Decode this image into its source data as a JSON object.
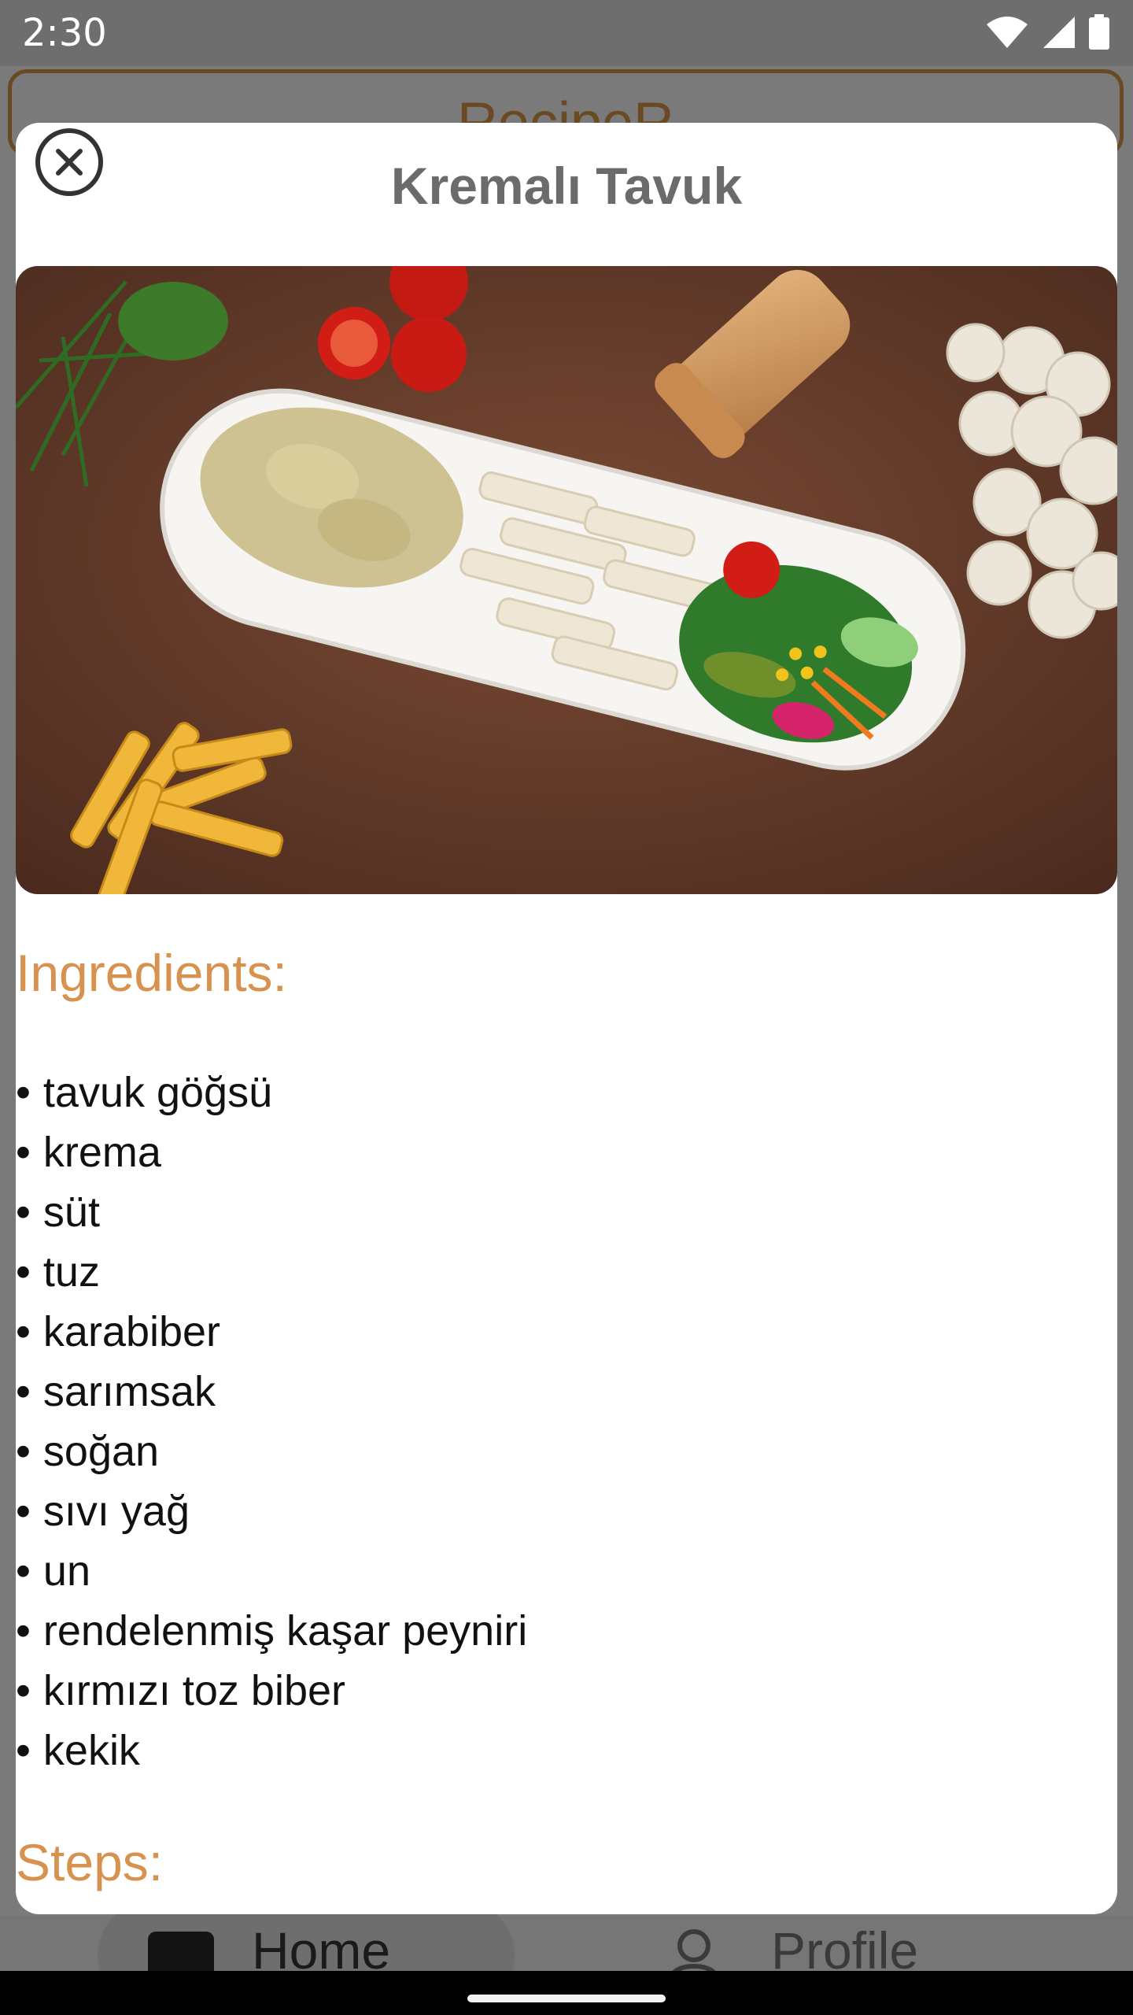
{
  "status_bar": {
    "time": "2:30",
    "icons": [
      "wifi-icon",
      "signal-icon",
      "battery-icon"
    ]
  },
  "background_app": {
    "header_title": "RecipeR",
    "nav": {
      "home_label": "Home",
      "profile_label": "Profile"
    }
  },
  "modal": {
    "title": "Kremalı Tavuk",
    "close_icon": "close-circle-icon",
    "image": "creamy-chicken-pasta-photo",
    "ingredients_heading": "Ingredients:",
    "bullet": "•",
    "ingredients": [
      "tavuk göğsü",
      "krema",
      "süt",
      "tuz",
      "karabiber",
      "sarımsak",
      "soğan",
      "sıvı yağ",
      "un",
      "rendelenmiş kaşar peyniri",
      "kırmızı toz biber",
      "kekik"
    ],
    "steps_heading": "Steps:"
  },
  "colors": {
    "accent": "#d8924f",
    "title_gray": "#6b6b6b",
    "brand_brown": "#6a4a22"
  }
}
